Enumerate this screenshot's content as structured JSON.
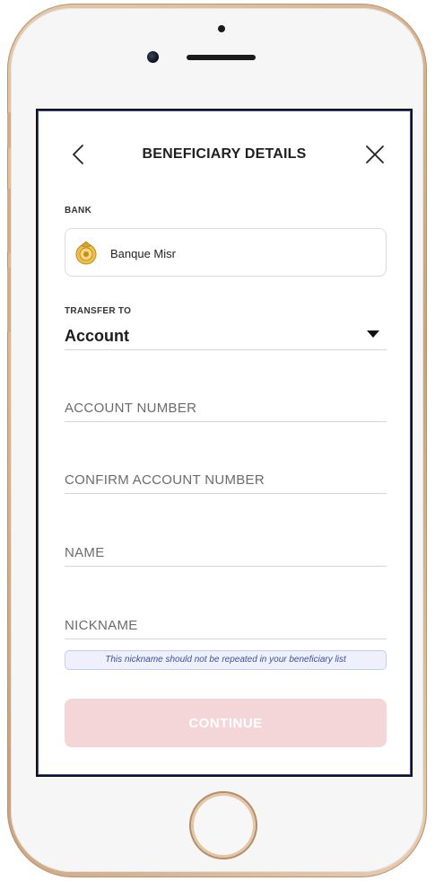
{
  "header": {
    "title": "BENEFICIARY DETAILS",
    "back_icon": "chevron-left-icon",
    "close_icon": "close-icon"
  },
  "bank": {
    "label": "BANK",
    "name": "Banque Misr",
    "logo_icon": "bank-logo-icon"
  },
  "transfer": {
    "label": "TRANSFER TO",
    "value": "Account",
    "dropdown_icon": "caret-down-icon"
  },
  "fields": {
    "account_number": {
      "placeholder": "ACCOUNT NUMBER",
      "value": ""
    },
    "confirm_account_number": {
      "placeholder": "CONFIRM ACCOUNT NUMBER",
      "value": ""
    },
    "name": {
      "placeholder": "NAME",
      "value": ""
    },
    "nickname": {
      "placeholder": "NICKNAME",
      "value": ""
    }
  },
  "nickname_hint": "This nickname should not be repeated in your beneficiary list",
  "continue_label": "CONTINUE",
  "colors": {
    "continue_disabled": "#f4d5d8",
    "hint_bg": "#eef1fb",
    "hint_text": "#3d4f9e",
    "frame_gold": "#d6b08c"
  }
}
